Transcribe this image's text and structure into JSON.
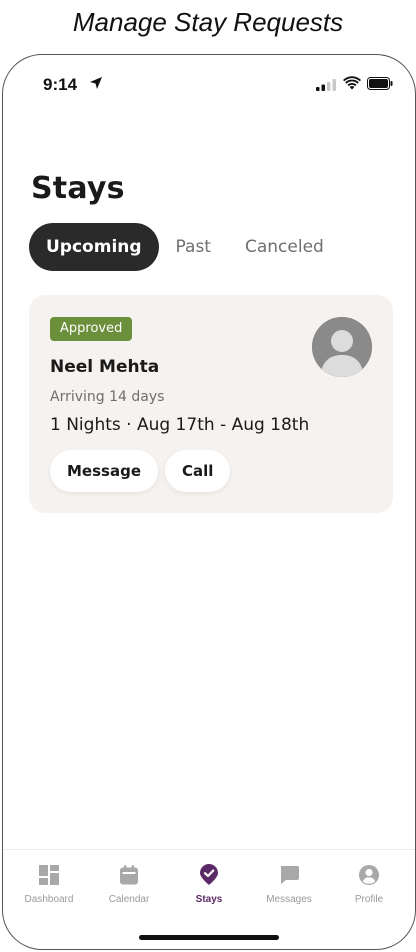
{
  "caption": "Manage Stay Requests",
  "status_bar": {
    "time": "9:14"
  },
  "page": {
    "title": "Stays"
  },
  "tabs": [
    {
      "label": "Upcoming",
      "active": true
    },
    {
      "label": "Past",
      "active": false
    },
    {
      "label": "Canceled",
      "active": false
    }
  ],
  "stay_card": {
    "status": "Approved",
    "guest_name": "Neel Mehta",
    "arrival": "Arriving 14 days",
    "dates": "1 Nights · Aug 17th - Aug 18th",
    "actions": {
      "message": "Message",
      "call": "Call"
    },
    "avatar_icon": "person-placeholder-icon"
  },
  "bottom_nav": [
    {
      "label": "Dashboard",
      "icon": "dashboard-icon",
      "active": false
    },
    {
      "label": "Calendar",
      "icon": "calendar-icon",
      "active": false
    },
    {
      "label": "Stays",
      "icon": "stays-check-pin-icon",
      "active": true
    },
    {
      "label": "Messages",
      "icon": "chat-bubble-icon",
      "active": false
    },
    {
      "label": "Profile",
      "icon": "user-circle-icon",
      "active": false
    }
  ],
  "colors": {
    "accent": "#5b2a66",
    "badge_green": "#6b8f3a",
    "tab_active_bg": "#2a2a2a",
    "card_bg": "#f6f2ef",
    "nav_inactive": "#9a9a9a"
  }
}
